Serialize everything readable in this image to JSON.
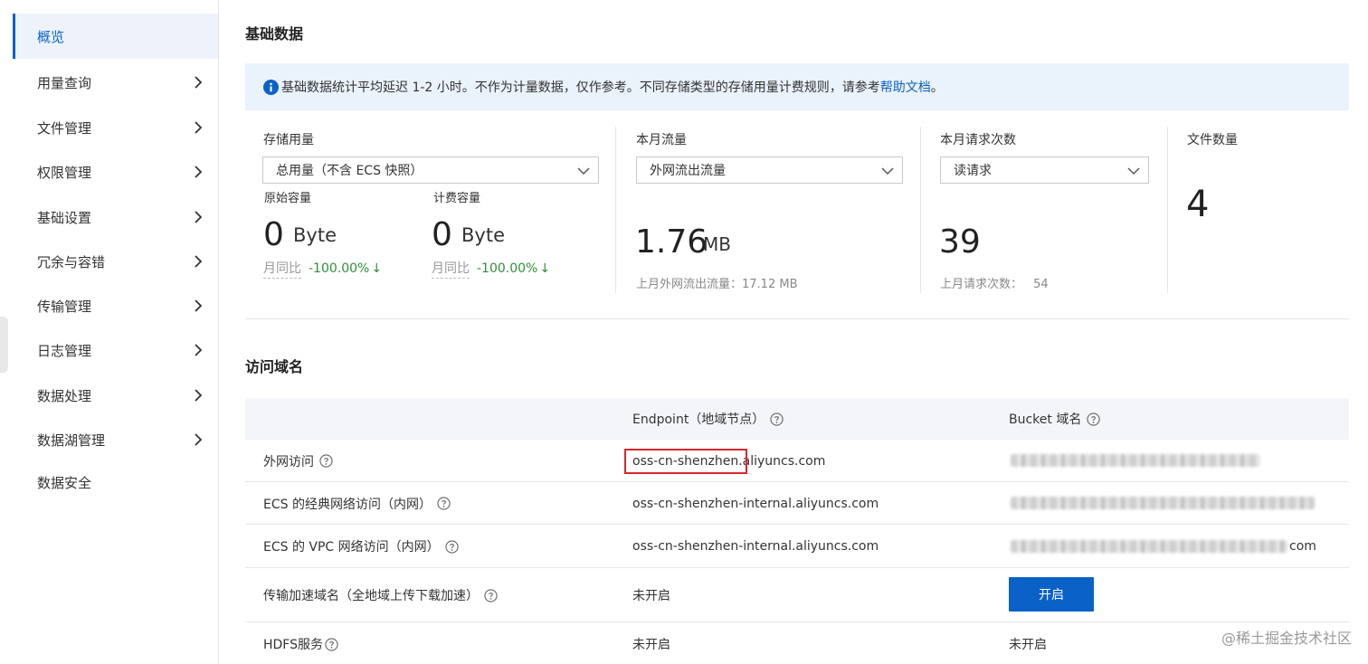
{
  "sidebar": {
    "items": [
      {
        "label": "概览",
        "active": true,
        "has_chevron": false
      },
      {
        "label": "用量查询",
        "has_chevron": true
      },
      {
        "label": "文件管理",
        "has_chevron": true
      },
      {
        "label": "权限管理",
        "has_chevron": true
      },
      {
        "label": "基础设置",
        "has_chevron": true
      },
      {
        "label": "冗余与容错",
        "has_chevron": true
      },
      {
        "label": "传输管理",
        "has_chevron": true
      },
      {
        "label": "日志管理",
        "has_chevron": true
      },
      {
        "label": "数据处理",
        "has_chevron": true
      },
      {
        "label": "数据湖管理",
        "has_chevron": true
      },
      {
        "label": "数据安全",
        "has_chevron": false
      }
    ]
  },
  "basic": {
    "title": "基础数据",
    "notice": {
      "text": "基础数据统计平均延迟 1-2 小时。不作为计量数据，仅作参考。不同存储类型的存储用量计费规则，请参考",
      "link": "帮助文档",
      "suffix": " 。"
    },
    "storage": {
      "label": "存储用量",
      "select": "总用量（不含 ECS 快照）",
      "raw": {
        "label": "原始容量",
        "value": "0",
        "unit": "Byte",
        "compare_label": "月同比",
        "compare_value": "-100.00%"
      },
      "billed": {
        "label": "计费容量",
        "value": "0",
        "unit": "Byte",
        "compare_label": "月同比",
        "compare_value": "-100.00%"
      }
    },
    "traffic": {
      "label": "本月流量",
      "select": "外网流出流量",
      "value": "1.76",
      "unit": "MB",
      "last_month": "上月外网流出流量：17.12 MB"
    },
    "requests": {
      "label": "本月请求次数",
      "select": "读请求",
      "value": "39",
      "last_month_label": "上月请求次数：",
      "last_month_value": "54"
    },
    "files": {
      "label": "文件数量",
      "value": "4"
    }
  },
  "domains": {
    "title": "访问域名",
    "headers": {
      "endpoint": "Endpoint（地域节点）",
      "bucket": "Bucket 域名"
    },
    "rows": [
      {
        "name": "外网访问",
        "endpoint": "oss-cn-shenzhen.aliyuncs.com",
        "bucket_suffix": ""
      },
      {
        "name": "ECS 的经典网络访问（内网）",
        "endpoint": "oss-cn-shenzhen-internal.aliyuncs.com",
        "bucket_suffix": ""
      },
      {
        "name": "ECS 的 VPC 网络访问（内网）",
        "endpoint": "oss-cn-shenzhen-internal.aliyuncs.com",
        "bucket_suffix": "com"
      },
      {
        "name": "传输加速域名（全地域上传下载加速）",
        "endpoint": "未开启",
        "button": "开启"
      },
      {
        "name": "HDFS服务",
        "endpoint": "未开启",
        "bucket": "未开启"
      }
    ]
  },
  "watermark": "@稀土掘金技术社区",
  "colors": {
    "accent": "#0a62c9",
    "positive": "#2f8f3a",
    "highlight": "#d9272e",
    "notice_bg": "#eaf2fb"
  }
}
